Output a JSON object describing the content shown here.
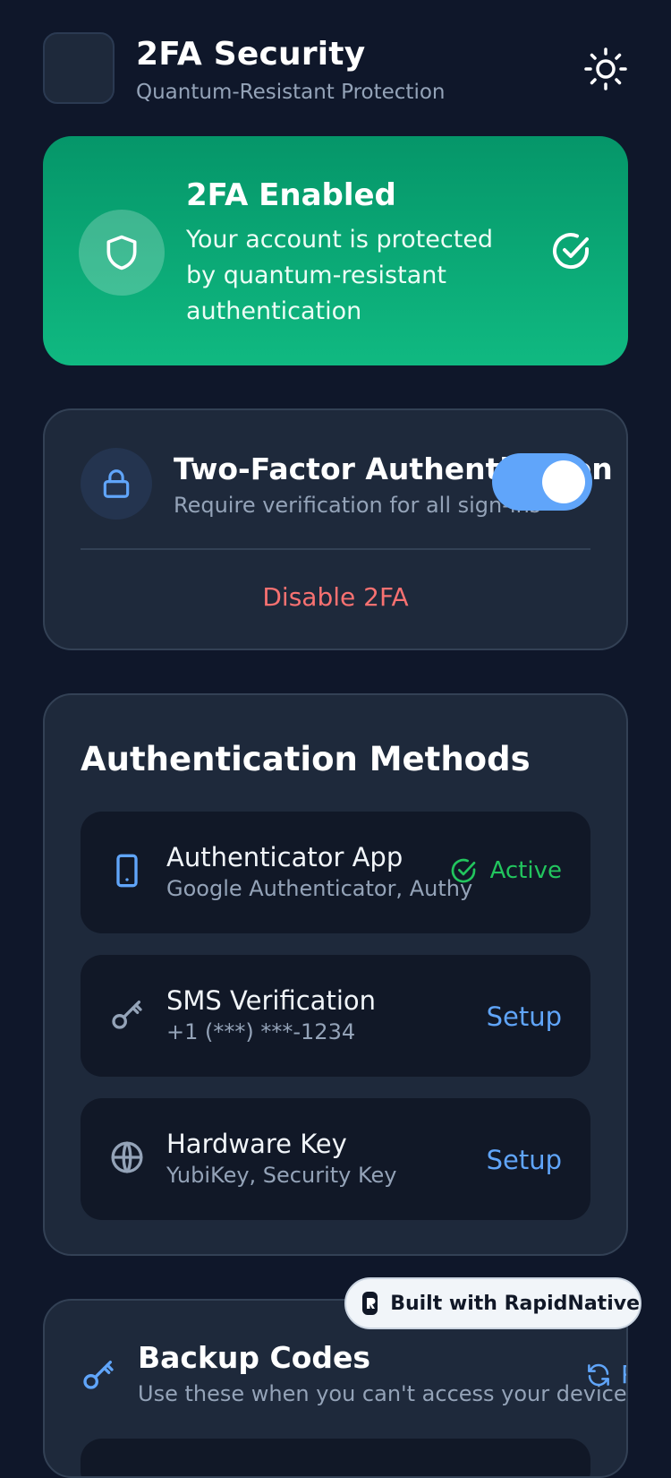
{
  "header": {
    "title": "2FA Security",
    "subtitle": "Quantum-Resistant Protection",
    "theme_icon": "sun-icon"
  },
  "status": {
    "title": "2FA Enabled",
    "description": "Your account is protected by quantum-resistant authentication",
    "icon": "shield-icon",
    "check_icon": "check-circle-icon",
    "colors": {
      "gradient_top": "#059669",
      "gradient_bottom": "#10b981"
    }
  },
  "two_factor": {
    "title": "Two-Factor Authentication",
    "subtitle": "Require verification for all sign-ins",
    "enabled": true,
    "disable_label": "Disable 2FA"
  },
  "methods": {
    "title": "Authentication Methods",
    "items": [
      {
        "title": "Authenticator App",
        "subtitle": "Google Authenticator, Authy",
        "icon": "smartphone-icon",
        "action": "Active"
      },
      {
        "title": "SMS Verification",
        "subtitle": "+1 (***) ***-1234",
        "icon": "key-icon",
        "action": "Setup"
      },
      {
        "title": "Hardware Key",
        "subtitle": "YubiKey, Security Key",
        "icon": "globe-icon",
        "action": "Setup"
      }
    ]
  },
  "backup": {
    "title": "Backup Codes",
    "subtitle": "Use these when you can't access your device",
    "regenerate_label": "Regenerate",
    "icon": "key-icon"
  },
  "badge": {
    "label": "Built with RapidNative"
  },
  "colors": {
    "background": "#0f172a",
    "card": "#1e293b",
    "accent": "#60a5fa",
    "danger": "#f87171",
    "success": "#22c55e"
  }
}
